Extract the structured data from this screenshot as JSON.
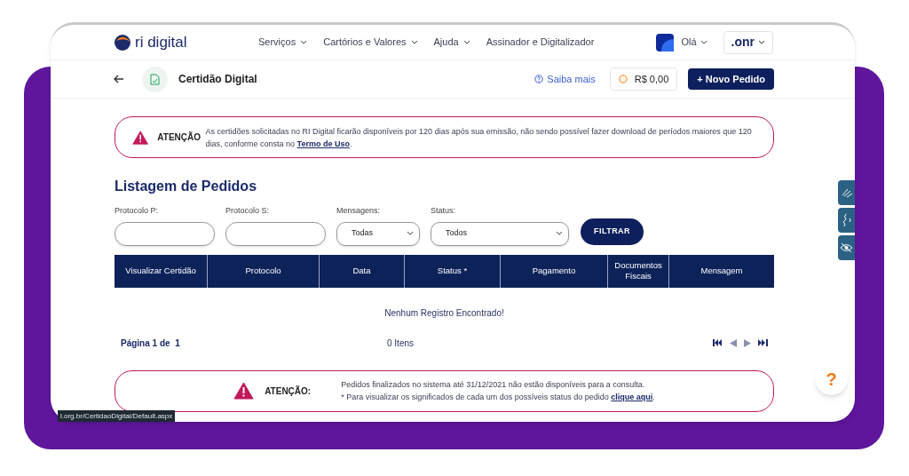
{
  "header": {
    "logo": "ri digital",
    "nav": [
      {
        "label": "Serviços",
        "dropdown": true
      },
      {
        "label": "Cartórios e Valores",
        "dropdown": true
      },
      {
        "label": "Ajuda",
        "dropdown": true
      },
      {
        "label": "Assinador e Digitalizador",
        "dropdown": false
      }
    ],
    "user": "Olá",
    "partner": ".onr"
  },
  "subheader": {
    "title": "Certidão Digital",
    "help_link": "Saiba mais",
    "balance": "R$ 0,00",
    "new_button": "+ Novo Pedido"
  },
  "notice_top": {
    "label": "ATENÇÃO",
    "text": "As certidões solicitadas no RI Digital ficarão disponíveis por 120 dias após sua emissão, não sendo possível fazer download de períodos maiores que 120 dias, conforme consta no ",
    "link": "Termo de Uso",
    "after": "."
  },
  "heading": "Listagem de Pedidos",
  "filters": [
    {
      "label": "Protocolo P:",
      "kind": "text"
    },
    {
      "label": "Protocolo S:",
      "kind": "text"
    },
    {
      "label": "Mensagens:",
      "kind": "select",
      "value": "Todas"
    },
    {
      "label": "Status:",
      "kind": "select",
      "value": "Todos"
    }
  ],
  "filter_button": "FILTRAR",
  "table": {
    "columns": [
      "Visualizar Certidão",
      "Protocolo",
      "Data",
      "Status *",
      "Pagamento",
      "Documentos Fiscais",
      "Mensagem"
    ],
    "empty": "Nenhum Registro Encontrado!"
  },
  "pagination": {
    "page": "Página 1 de  1",
    "count": "0 Itens"
  },
  "notice_bottom": {
    "label": "ATENÇÃO:",
    "line1": "Pedidos finalizados no sistema até 31/12/2021 não estão disponíveis para a consulta.",
    "line2": "* Para visualizar os significados de cada um dos possíveis status do pedido ",
    "link": "clique aqui",
    "after": "."
  },
  "help_button": "?",
  "status_url": "l.org.br/CertidaoDigital/Default.aspx"
}
